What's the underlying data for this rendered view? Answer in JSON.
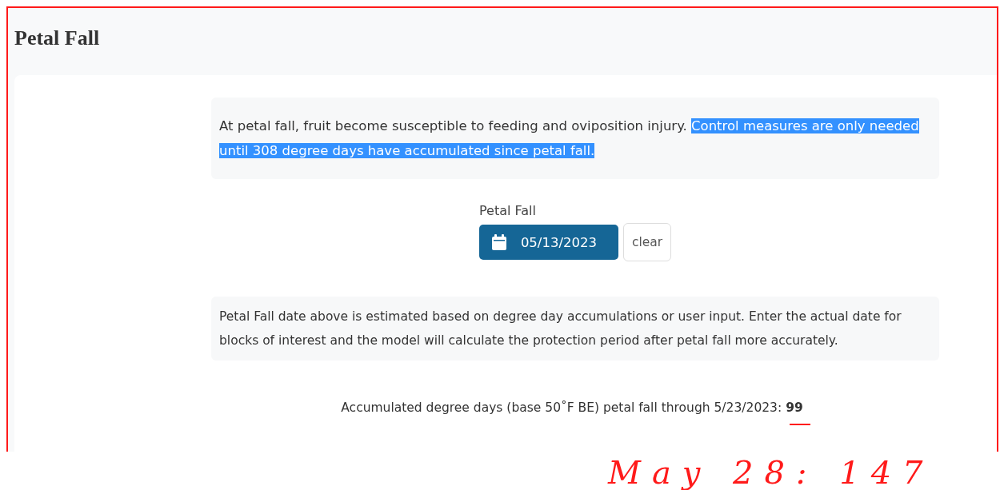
{
  "page": {
    "title": "Petal Fall"
  },
  "intro": {
    "segments": [
      {
        "text": "At petal fall, fruit become susceptible to feeding and oviposition injury. ",
        "highlighted": false
      },
      {
        "text": "Control measures are only needed until 308 degree days have accumulated since petal fall.",
        "highlighted": true
      }
    ]
  },
  "date_picker": {
    "label": "Petal Fall",
    "value": "05/13/2023",
    "clear_button": "clear"
  },
  "note": "Petal Fall date above is estimated based on degree day accumulations or user input. Enter the actual date for blocks of interest and the model will calculate the protection period after petal fall more accurately.",
  "accumulated": {
    "text": "Accumulated degree days (base 50˚F BE) petal fall through 5/23/2023: **99**",
    "underlined": true
  },
  "annotation": {
    "text": "May 28: 147"
  }
}
